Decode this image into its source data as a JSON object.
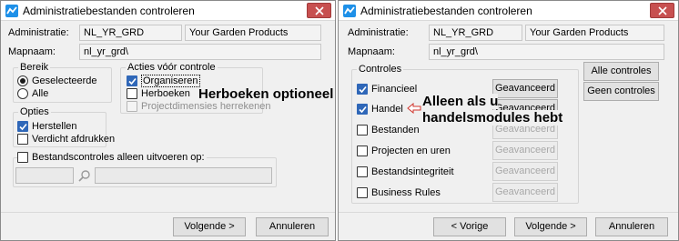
{
  "dialog1": {
    "title": "Administratiebestanden controleren",
    "administratie_label": "Administratie:",
    "administratie_code": "NL_YR_GRD",
    "administratie_name": "Your Garden Products",
    "mapnaam_label": "Mapnaam:",
    "mapnaam_value": "nl_yr_grd\\",
    "bereik": {
      "legend": "Bereik",
      "options": [
        {
          "label": "Geselecteerde",
          "selected": true
        },
        {
          "label": "Alle",
          "selected": false
        }
      ]
    },
    "acties": {
      "legend": "Acties vóór controle",
      "items": [
        {
          "label": "Organiseren",
          "checked": true,
          "disabled": false
        },
        {
          "label": "Herboeken",
          "checked": false,
          "disabled": false
        },
        {
          "label": "Projectdimensies herrekenen",
          "checked": false,
          "disabled": true
        }
      ]
    },
    "opties": {
      "legend": "Opties",
      "items": [
        {
          "label": "Herstellen",
          "checked": true
        },
        {
          "label": "Verdicht afdrukken",
          "checked": false
        }
      ]
    },
    "bestandscontroles_label": "Bestandscontroles alleen uitvoeren op:",
    "annotation": "Herboeken optioneel",
    "buttons": {
      "next": "Volgende >",
      "cancel": "Annuleren"
    }
  },
  "dialog2": {
    "title": "Administratiebestanden controleren",
    "administratie_label": "Administratie:",
    "administratie_code": "NL_YR_GRD",
    "administratie_name": "Your Garden Products",
    "mapnaam_label": "Mapnaam:",
    "mapnaam_value": "nl_yr_grd\\",
    "controles": {
      "legend": "Controles",
      "items": [
        {
          "label": "Financieel",
          "checked": true,
          "button": "Geavanceerd",
          "button_enabled": true
        },
        {
          "label": "Handel",
          "checked": true,
          "button": "Geavanceerd",
          "button_enabled": true
        },
        {
          "label": "Bestanden",
          "checked": false,
          "button": "Geavanceerd",
          "button_enabled": false
        },
        {
          "label": "Projecten en uren",
          "checked": false,
          "button": "Geavanceerd",
          "button_enabled": false
        },
        {
          "label": "Bestandsintegriteit",
          "checked": false,
          "button": "Geavanceerd",
          "button_enabled": false
        },
        {
          "label": "Business Rules",
          "checked": false,
          "button": "Geavanceerd",
          "button_enabled": false
        }
      ]
    },
    "all_controls": "Alle controles",
    "no_controls": "Geen controles",
    "annotation_line1": "Alleen als u",
    "annotation_line2": "handelsmodules hebt",
    "buttons": {
      "back": "< Vorige",
      "next": "Volgende >",
      "cancel": "Annuleren"
    }
  },
  "colors": {
    "app_icon": "#1e90e8",
    "close_button": "#c75050",
    "checkbox_checked": "#2f67b8",
    "annotation_arrow": "#d0342c"
  }
}
